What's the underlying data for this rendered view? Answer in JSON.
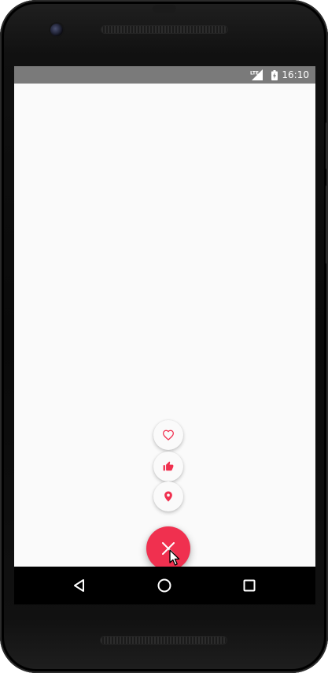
{
  "status_bar": {
    "time": "16:10",
    "network_icon": "lte-signal-icon",
    "battery_icon": "battery-charging-icon"
  },
  "colors": {
    "accent": "#f0304f",
    "fab_mini_bg": "#fafafa",
    "screen_bg": "#fafafa",
    "status_bar_bg": "#7a7a7a",
    "nav_bar_bg": "#000000"
  },
  "fab_menu": {
    "state": "expanded",
    "items": [
      {
        "icon": "heart-outline-icon"
      },
      {
        "icon": "thumbs-up-icon"
      },
      {
        "icon": "map-pin-icon"
      }
    ],
    "main_button_icon": "close-icon"
  },
  "nav_bar": {
    "buttons": [
      {
        "icon": "back-icon"
      },
      {
        "icon": "home-icon"
      },
      {
        "icon": "recents-icon"
      }
    ]
  }
}
